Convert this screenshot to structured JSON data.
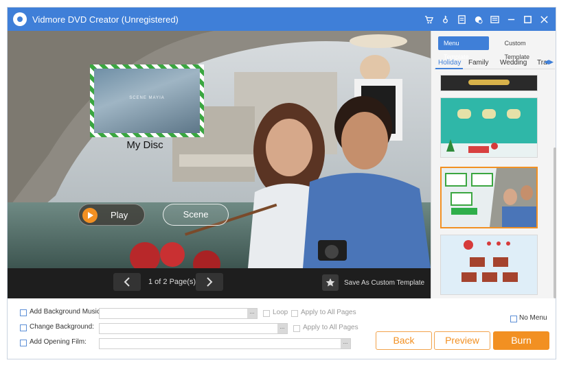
{
  "app": {
    "title": "Vidmore DVD Creator (Unregistered)"
  },
  "titlebar_icons": [
    "cart-icon",
    "key-icon",
    "document-icon",
    "feedback-icon",
    "menu-icon",
    "minimize-icon",
    "maximize-icon",
    "close-icon"
  ],
  "preview": {
    "thumbnail_caption": "SCENE MAYIA",
    "disc_title": "My Disc",
    "play_label": "Play",
    "scene_label": "Scene"
  },
  "nav": {
    "page_info": "1 of 2 Page(s)",
    "save_template_label": "Save As Custom Template"
  },
  "templates": {
    "tabs": [
      {
        "label": "Menu Template",
        "active": true
      },
      {
        "label": "Custom Template",
        "active": false
      }
    ],
    "categories": [
      "Holiday",
      "Family",
      "Wedding",
      "Tra"
    ],
    "active_category": "Holiday",
    "selected_index": 2
  },
  "options": {
    "background_music_label": "Add Background Music:",
    "loop_label": "Loop",
    "apply_all_1": "Apply to All Pages",
    "change_background_label": "Change Background:",
    "apply_all_2": "Apply to All Pages",
    "opening_film_label": "Add Opening Film:",
    "no_menu_label": "No Menu",
    "browse_label": "..."
  },
  "buttons": {
    "back": "Back",
    "preview": "Preview",
    "burn": "Burn"
  },
  "colors": {
    "titlebar": "#3f7fd8",
    "accent": "#f29022"
  }
}
